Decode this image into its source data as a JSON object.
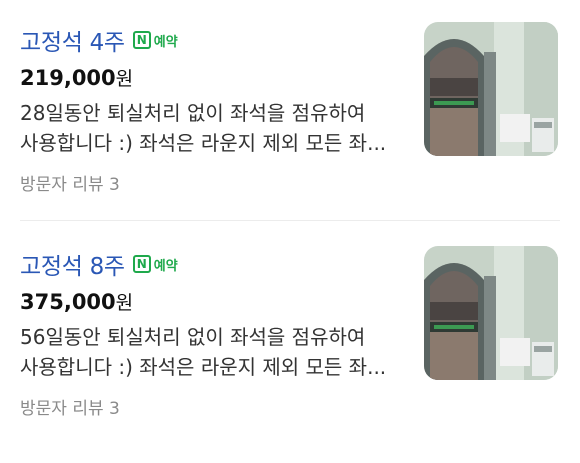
{
  "listings": [
    {
      "title": "고정석 4주",
      "npay_badge": "N",
      "npay_label": "예약",
      "price": "219,000",
      "currency": "원",
      "description_line1": "28일동안 퇴실처리 없이 좌석을 점유하여",
      "description_line2": "사용합니다 :) 좌석은 라운지 제외 모든 좌...",
      "reviews": "방문자 리뷰 3",
      "thumbnail_icon": "room-photo"
    },
    {
      "title": "고정석 8주",
      "npay_badge": "N",
      "npay_label": "예약",
      "price": "375,000",
      "currency": "원",
      "description_line1": "56일동안 퇴실처리 없이 좌석을 점유하여",
      "description_line2": "사용합니다 :) 좌석은 라운지 제외 모든 좌...",
      "reviews": "방문자 리뷰 3",
      "thumbnail_icon": "room-photo"
    }
  ],
  "colors": {
    "title": "#2a57b5",
    "npay_green": "#1fa94c",
    "price": "#111111",
    "description": "#333333",
    "reviews": "#8a8a8a"
  }
}
